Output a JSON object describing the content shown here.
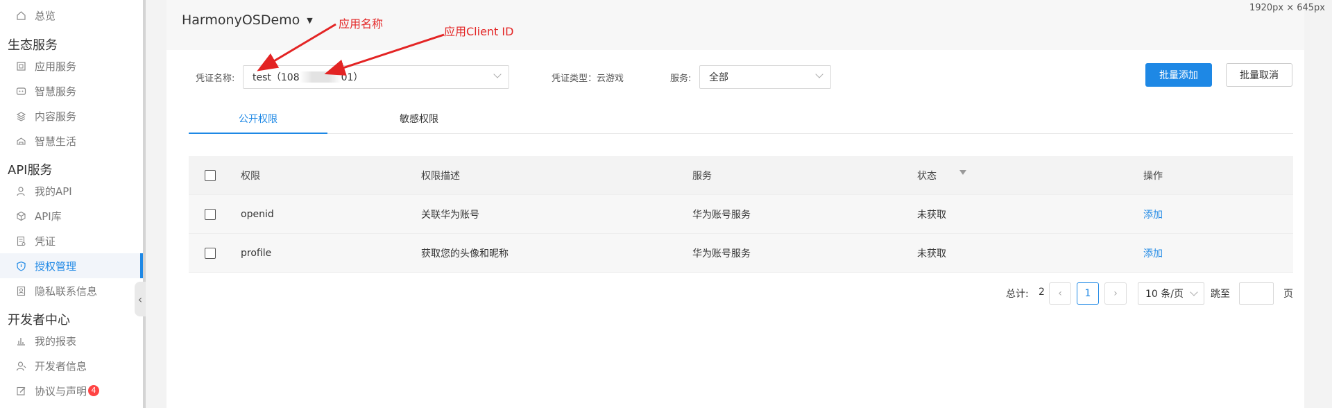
{
  "screen_size_label": "1920px × 645px",
  "sidebar": {
    "items_top": [
      {
        "label": "总览",
        "icon": "home-icon"
      }
    ],
    "groups": [
      {
        "title": "生态服务",
        "items": [
          {
            "label": "应用服务",
            "icon": "app-service-icon"
          },
          {
            "label": "智慧服务",
            "icon": "smart-service-icon"
          },
          {
            "label": "内容服务",
            "icon": "layers-icon"
          },
          {
            "label": "智慧生活",
            "icon": "smart-life-icon"
          }
        ]
      },
      {
        "title": "API服务",
        "items": [
          {
            "label": "我的API",
            "icon": "user-api-icon"
          },
          {
            "label": "API库",
            "icon": "cube-icon"
          },
          {
            "label": "凭证",
            "icon": "credential-icon"
          },
          {
            "label": "授权管理",
            "icon": "shield-icon",
            "active": true
          },
          {
            "label": "隐私联系信息",
            "icon": "privacy-icon"
          }
        ]
      },
      {
        "title": "开发者中心",
        "items": [
          {
            "label": "我的报表",
            "icon": "chart-icon"
          },
          {
            "label": "开发者信息",
            "icon": "developer-icon"
          },
          {
            "label": "协议与声明",
            "icon": "edit-icon",
            "badge": "4"
          }
        ]
      }
    ],
    "collapse_glyph": "‹"
  },
  "header": {
    "app_name": "HarmonyOSDemo",
    "caret": "▼"
  },
  "filters": {
    "credential_label": "凭证名称:",
    "credential_value_prefix": "test（108",
    "credential_value_suffix": "01）",
    "credential_type": "凭证类型：云游戏",
    "service_label": "服务:",
    "service_value": "全部"
  },
  "buttons": {
    "batch_add": "批量添加",
    "batch_cancel": "批量取消"
  },
  "tabs": [
    {
      "label": "公开权限",
      "active": true
    },
    {
      "label": "敏感权限",
      "active": false
    }
  ],
  "table": {
    "headers": [
      "权限",
      "权限描述",
      "服务",
      "状态",
      "操作"
    ],
    "rows": [
      {
        "permission": "openid",
        "description": "关联华为账号",
        "service": "华为账号服务",
        "status": "未获取",
        "action": "添加"
      },
      {
        "permission": "profile",
        "description": "获取您的头像和昵称",
        "service": "华为账号服务",
        "status": "未获取",
        "action": "添加"
      }
    ]
  },
  "pagination": {
    "total_label": "总计:",
    "total": "2",
    "prev": "‹",
    "current": "1",
    "next": "›",
    "page_size": "10 条/页",
    "jump_label": "跳至",
    "page_suffix": "页"
  },
  "annotations": {
    "app_name_note": "应用名称",
    "client_id_note": "应用Client ID",
    "color": "#e32424"
  },
  "colors": {
    "accent": "#1e88e5",
    "badge": "#f44444"
  }
}
